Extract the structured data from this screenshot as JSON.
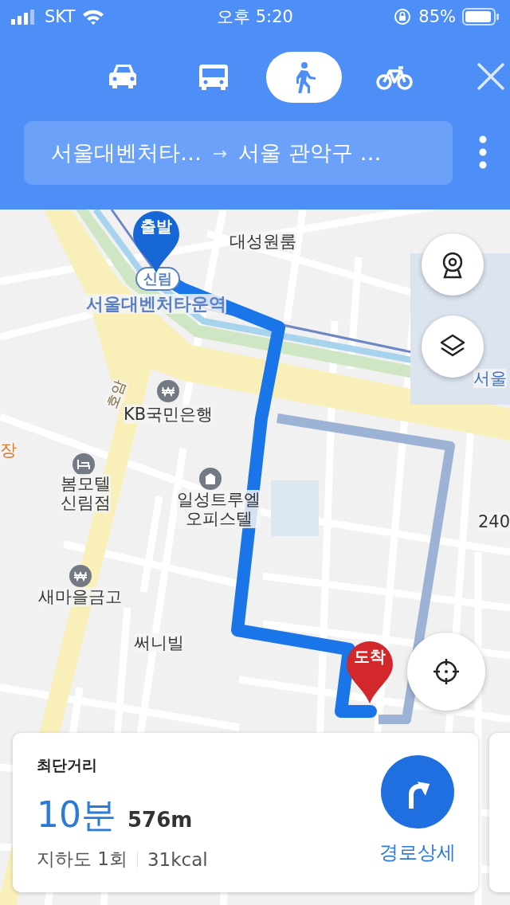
{
  "status_bar": {
    "carrier": "SKT",
    "time": "오후 5:20",
    "battery": "85%"
  },
  "modes": [
    {
      "kind": "car",
      "selected": false
    },
    {
      "kind": "bus",
      "selected": false
    },
    {
      "kind": "walk",
      "selected": true
    },
    {
      "kind": "bike",
      "selected": false
    }
  ],
  "route": {
    "origin": "서울대벤처타…",
    "arrow": "→",
    "destination": "서울 관악구 …"
  },
  "map": {
    "start_marker": "출발",
    "end_marker": "도착",
    "station_badge": "신림",
    "labels": [
      {
        "text": "대성원룸",
        "kind": "place"
      },
      {
        "text": "서울대벤처타운역",
        "kind": "station"
      },
      {
        "text": "KB국민은행",
        "kind": "bank"
      },
      {
        "text": "봄모텔\n신림점",
        "kind": "hotel"
      },
      {
        "text": "일성트루엘\n오피스텔",
        "kind": "building"
      },
      {
        "text": "새마을금고",
        "kind": "bank"
      },
      {
        "text": "써니빌",
        "kind": "place"
      },
      {
        "text": "240",
        "kind": "place"
      },
      {
        "text": "서울",
        "kind": "school"
      },
      {
        "text": "호암",
        "kind": "road"
      },
      {
        "text": "장",
        "kind": "orange"
      }
    ]
  },
  "card": {
    "title": "최단거리",
    "duration": "10분",
    "distance": "576m",
    "details": [
      "지하도 1회",
      "31kcal"
    ],
    "action": "경로상세"
  }
}
